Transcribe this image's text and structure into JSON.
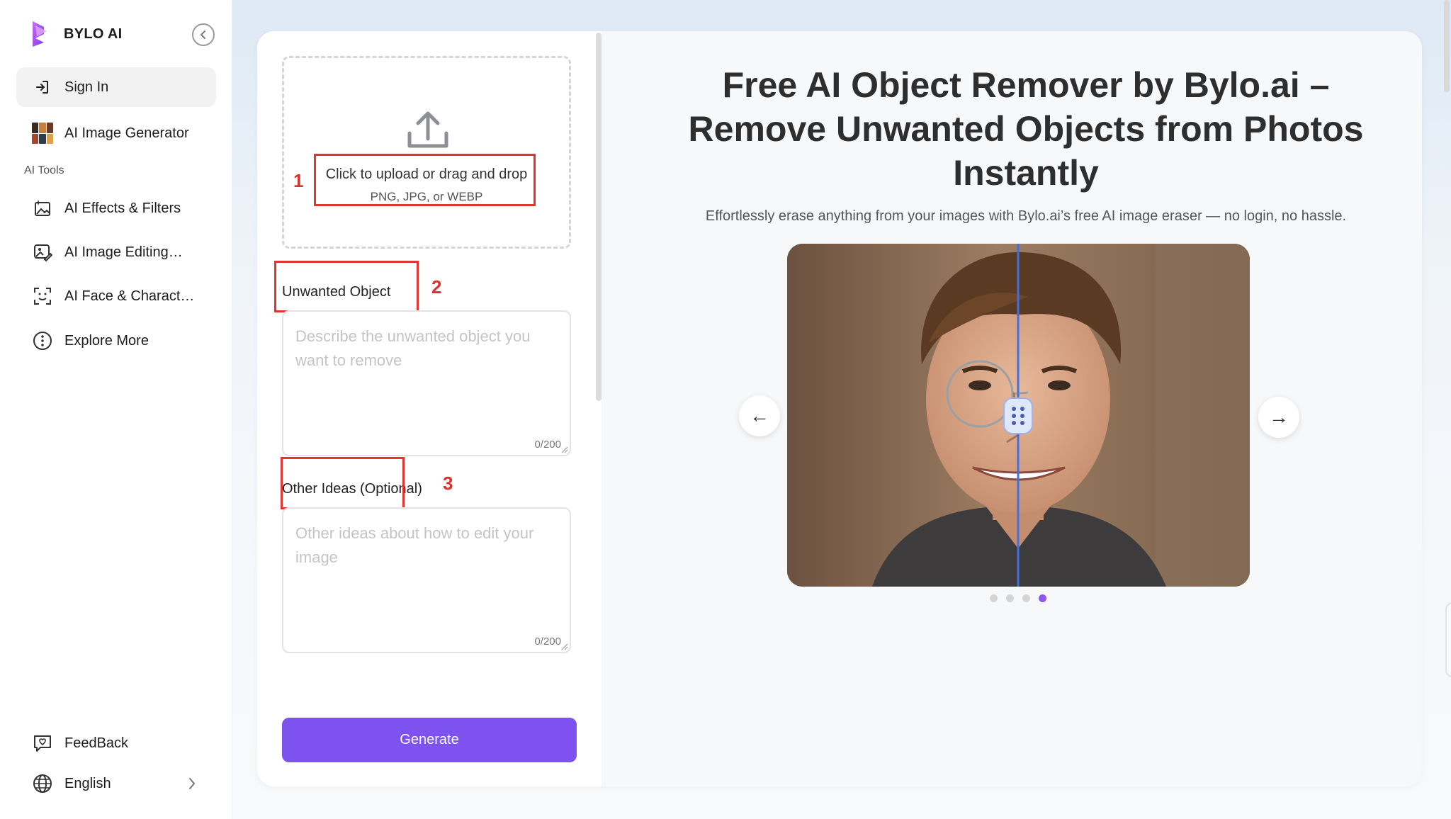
{
  "brand": {
    "name": "BYLO AI"
  },
  "sidebar": {
    "sign_in": "Sign In",
    "image_generator": "AI Image Generator",
    "section_label": "AI Tools",
    "items": [
      {
        "label": "AI Effects & Filters",
        "icon": "sparkle-image-icon"
      },
      {
        "label": "AI Image Editing…",
        "icon": "image-edit-icon"
      },
      {
        "label": "AI Face & Charact…",
        "icon": "face-scan-icon"
      },
      {
        "label": "Explore More",
        "icon": "more-circle-icon"
      }
    ],
    "feedback": "FeedBack",
    "language": "English"
  },
  "form": {
    "upload_text": "Click to upload or drag and drop",
    "upload_sub": "PNG, JPG, or WEBP",
    "unwanted_label": "Unwanted Object",
    "unwanted_placeholder": "Describe the unwanted object you want to remove",
    "unwanted_count": "0/200",
    "other_label": "Other Ideas (Optional)",
    "other_placeholder": "Other ideas about how to edit your image",
    "other_count": "0/200",
    "generate": "Generate"
  },
  "annotations": {
    "one": "1",
    "two": "2",
    "three": "3"
  },
  "hero": {
    "title": "Free AI Object Remover by Bylo.ai – Remove Unwanted Objects from Photos Instantly",
    "subtitle": "Effortlessly erase anything from your images with Bylo.ai’s free AI image eraser — no login, no hassle.",
    "prev_arrow": "←",
    "next_arrow": "→",
    "carousel_dots": 4,
    "active_dot": 4
  },
  "colors": {
    "accent": "#7d52ef",
    "annotation_red": "#e0362e",
    "active_dot": "#8d58ea"
  }
}
